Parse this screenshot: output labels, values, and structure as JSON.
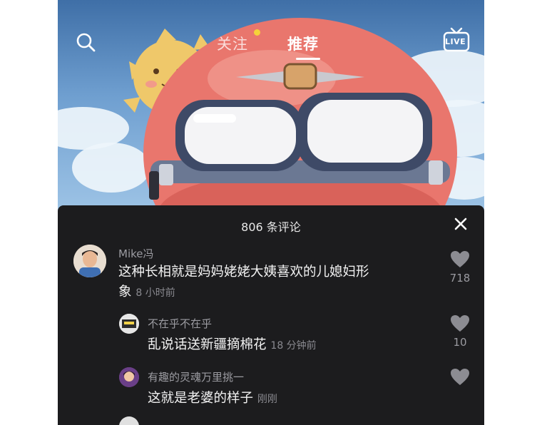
{
  "top_nav": {
    "tabs": [
      {
        "label": "关注",
        "active": false,
        "has_dot": true
      },
      {
        "label": "推荐",
        "active": true
      }
    ],
    "live_label": "LIVE"
  },
  "comments_sheet": {
    "title": "806 条评论",
    "comments": [
      {
        "username": "Mike冯",
        "text_line1": "这种长相就是妈妈姥姥大姨喜欢的儿媳妇形",
        "text_line2": "象",
        "time": "8 小时前",
        "likes": "718"
      },
      {
        "username": "不在乎不在乎",
        "text": "乱说话送新疆摘棉花",
        "time": "18 分钟前",
        "likes": "10"
      },
      {
        "username": "有趣的灵魂万里挑一",
        "text": "这就是老婆的样子",
        "time": "刚刚",
        "likes": ""
      }
    ]
  },
  "colors": {
    "sheet_bg": "#1c1c1e",
    "sky": "#6f9fd0",
    "helmet": "#e9766d",
    "accent_dot": "#f5d23a"
  }
}
